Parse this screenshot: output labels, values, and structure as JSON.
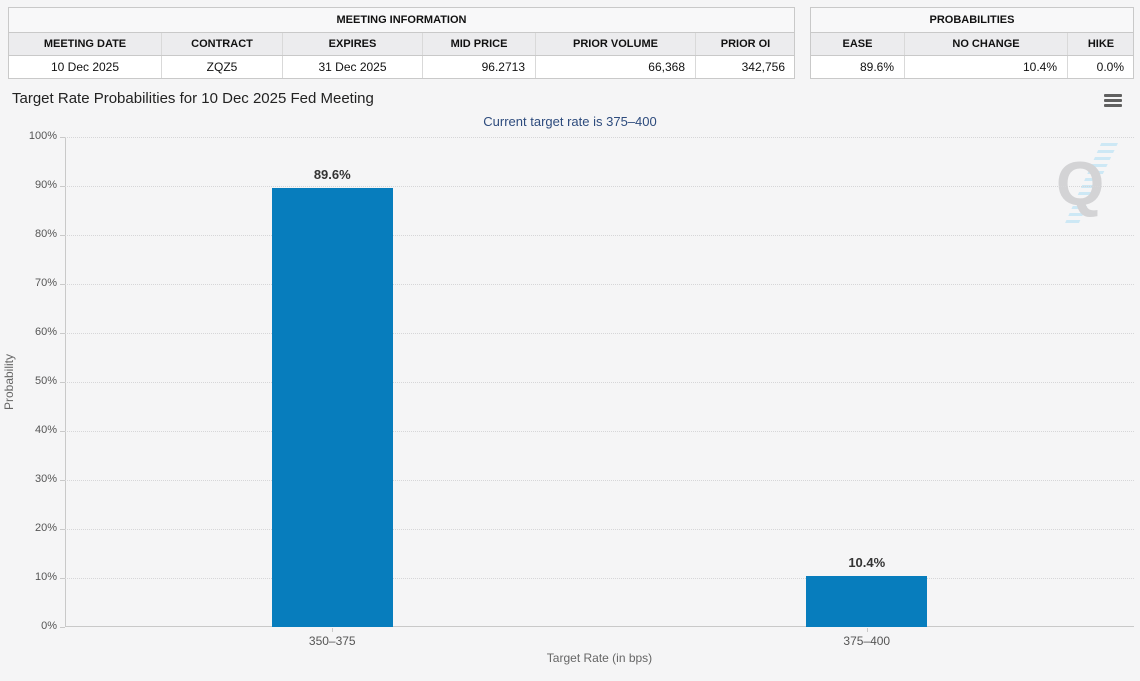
{
  "meeting_information": {
    "title": "MEETING INFORMATION",
    "columns": [
      "MEETING DATE",
      "CONTRACT",
      "EXPIRES",
      "MID PRICE",
      "PRIOR VOLUME",
      "PRIOR OI"
    ],
    "values": [
      "10 Dec 2025",
      "ZQZ5",
      "31 Dec 2025",
      "96.2713",
      "66,368",
      "342,756"
    ]
  },
  "probabilities_table": {
    "title": "PROBABILITIES",
    "columns": [
      "EASE",
      "NO CHANGE",
      "HIKE"
    ],
    "values": [
      "89.6%",
      "10.4%",
      "0.0%"
    ]
  },
  "chart": {
    "title": "Target Rate Probabilities for 10 Dec 2025 Fed Meeting",
    "subtitle": "Current target rate is 375–400",
    "menu_icon": "hamburger-menu-icon",
    "watermark_letter": "Q"
  },
  "chart_data": {
    "type": "bar",
    "categories": [
      "350–375",
      "375–400"
    ],
    "values": [
      89.6,
      10.4
    ],
    "data_labels": [
      "89.6%",
      "10.4%"
    ],
    "title": "Target Rate Probabilities for 10 Dec 2025 Fed Meeting",
    "subtitle": "Current target rate is 375–400",
    "xlabel": "Target Rate (in bps)",
    "ylabel": "Probability",
    "ylim": [
      0,
      100
    ],
    "ytick_step": 10,
    "ytick_suffix": "%",
    "grid": "dotted horizontal, legend off",
    "bar_color": "#077dbd"
  },
  "colors": {
    "bar": "#077dbd",
    "subtitle_text": "#2d4b7d",
    "page_background": "#f5f5f6",
    "watermark_stripe": "#cde8f5"
  }
}
